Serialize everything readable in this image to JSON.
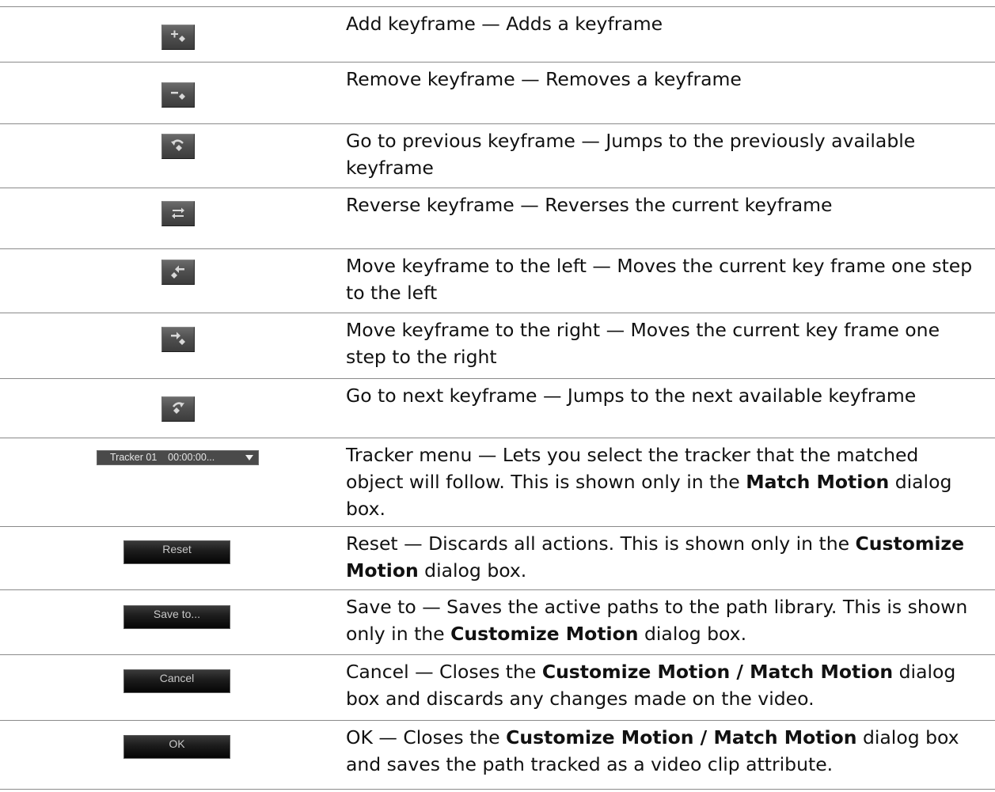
{
  "rows": [
    {
      "icon": "add-keyframe-icon",
      "text": "Add keyframe — Adds a keyframe"
    },
    {
      "icon": "remove-keyframe-icon",
      "text": "Remove keyframe — Removes a keyframe"
    },
    {
      "icon": "previous-keyframe-icon",
      "text": "Go to previous keyframe — Jumps to the previously available keyframe"
    },
    {
      "icon": "reverse-keyframe-icon",
      "text": "Reverse keyframe — Reverses the current keyframe"
    },
    {
      "icon": "move-keyframe-left-icon",
      "text": "Move keyframe to the left — Moves the current key frame one step to the left"
    },
    {
      "icon": "move-keyframe-right-icon",
      "text": "Move keyframe to the right — Moves the current key frame one step to the right"
    },
    {
      "icon": "next-keyframe-icon",
      "text": "Go to next keyframe — Jumps to the next available keyframe"
    },
    {
      "control_label": "Tracker 01    00:00:00...",
      "text_parts": [
        "Tracker menu — Lets you select the tracker that the matched object will follow. This is shown only in the ",
        "Match Motion",
        " dialog box."
      ]
    },
    {
      "button_label": "Reset",
      "text_parts": [
        "Reset — Discards all actions. This is shown only in the ",
        "Customize Motion",
        " dialog box."
      ]
    },
    {
      "button_label": "Save to...",
      "text_parts": [
        "Save to — Saves the active paths to the path library. This is shown only in the ",
        "Customize Motion",
        " dialog box."
      ]
    },
    {
      "button_label": "Cancel",
      "text_parts": [
        "Cancel — Closes the ",
        "Customize Motion / Match Motion",
        " dialog box and discards any changes made on the video."
      ]
    },
    {
      "button_label": "OK",
      "text_parts": [
        "OK — Closes the ",
        "Customize Motion / Match Motion",
        " dialog box and saves the path tracked as a video clip attribute."
      ]
    }
  ],
  "colors": {
    "rule": "#8a8a8a",
    "icon_glyph": "#d8d8d8",
    "button_text": "#c8c8c8"
  }
}
